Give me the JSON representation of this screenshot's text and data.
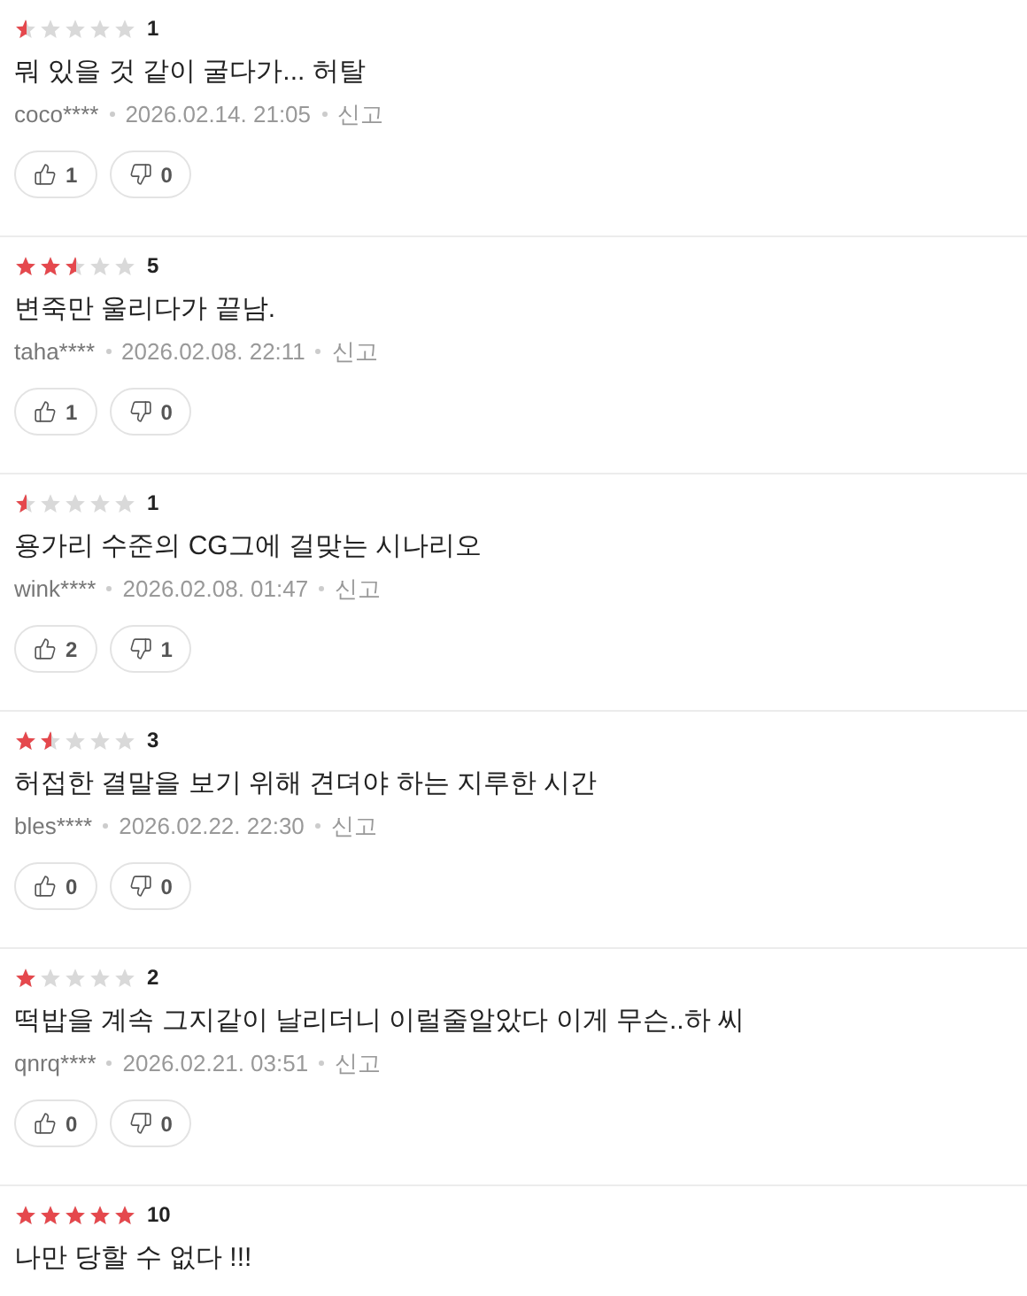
{
  "reviews": [
    {
      "stars": 0.5,
      "score": "1",
      "text": "뭐 있을 것 같이 굴다가... 허탈",
      "user": "coco****",
      "date": "2026.02.14. 21:05",
      "report": "신고",
      "likes": "1",
      "dislikes": "0"
    },
    {
      "stars": 2.5,
      "score": "5",
      "text": "변죽만 울리다가 끝남.",
      "user": "taha****",
      "date": "2026.02.08. 22:11",
      "report": "신고",
      "likes": "1",
      "dislikes": "0"
    },
    {
      "stars": 0.5,
      "score": "1",
      "text": "용가리 수준의 CG그에 걸맞는 시나리오",
      "user": "wink****",
      "date": "2026.02.08. 01:47",
      "report": "신고",
      "likes": "2",
      "dislikes": "1"
    },
    {
      "stars": 1.5,
      "score": "3",
      "text": "허접한 결말을 보기 위해 견뎌야 하는 지루한 시간",
      "user": "bles****",
      "date": "2026.02.22. 22:30",
      "report": "신고",
      "likes": "0",
      "dislikes": "0"
    },
    {
      "stars": 1,
      "score": "2",
      "text": "떡밥을 계속 그지같이 날리더니 이럴줄알았다 이게 무슨..하 씨",
      "user": "qnrq****",
      "date": "2026.02.21. 03:51",
      "report": "신고",
      "likes": "0",
      "dislikes": "0"
    },
    {
      "stars": 5,
      "score": "10",
      "text": "나만 당할 수 없다 !!!"
    }
  ]
}
